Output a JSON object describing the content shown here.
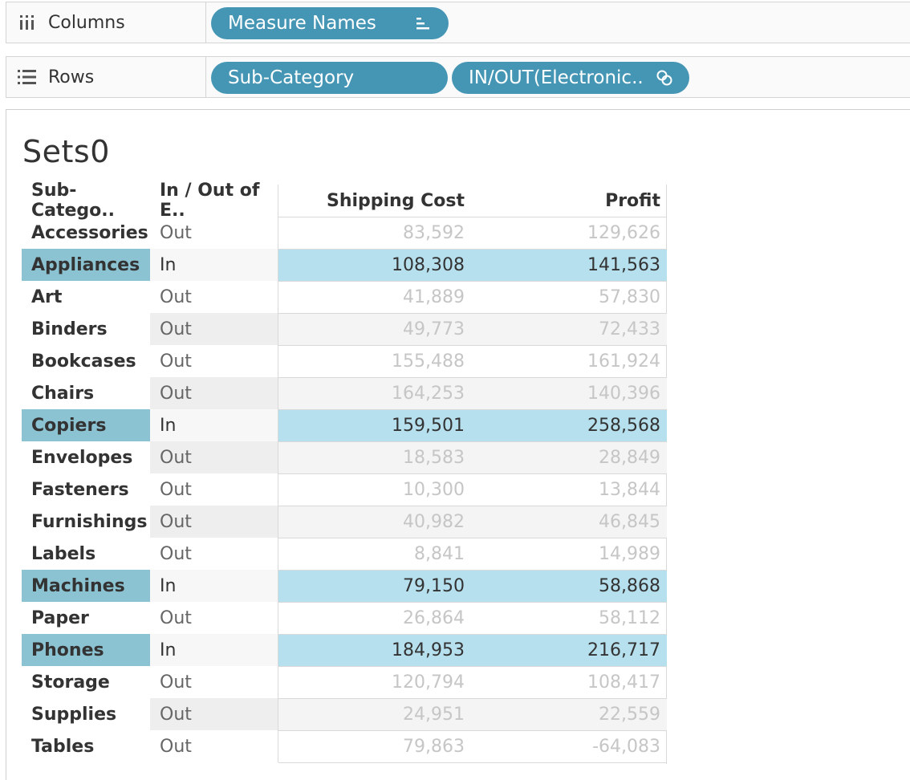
{
  "columns_shelf": {
    "label": "Columns",
    "icon": "columns-icon",
    "pills": [
      {
        "label": "Measure Names",
        "icon": "sort-icon"
      }
    ]
  },
  "rows_shelf": {
    "label": "Rows",
    "icon": "rows-icon",
    "pills": [
      {
        "label": "Sub-Category"
      },
      {
        "label": "IN/OUT(Electronic..",
        "icon": "set-icon"
      }
    ]
  },
  "sheet": {
    "title": "Sets0",
    "headers": {
      "sub_category": "Sub-Catego..",
      "in_out": "In / Out of E..",
      "shipping_cost": "Shipping Cost",
      "profit": "Profit"
    },
    "rows": [
      {
        "sub": "Accessories",
        "io": "Out",
        "ship": "83,592",
        "profit": "129,626"
      },
      {
        "sub": "Appliances",
        "io": "In",
        "ship": "108,308",
        "profit": "141,563"
      },
      {
        "sub": "Art",
        "io": "Out",
        "ship": "41,889",
        "profit": "57,830"
      },
      {
        "sub": "Binders",
        "io": "Out",
        "ship": "49,773",
        "profit": "72,433"
      },
      {
        "sub": "Bookcases",
        "io": "Out",
        "ship": "155,488",
        "profit": "161,924"
      },
      {
        "sub": "Chairs",
        "io": "Out",
        "ship": "164,253",
        "profit": "140,396"
      },
      {
        "sub": "Copiers",
        "io": "In",
        "ship": "159,501",
        "profit": "258,568"
      },
      {
        "sub": "Envelopes",
        "io": "Out",
        "ship": "18,583",
        "profit": "28,849"
      },
      {
        "sub": "Fasteners",
        "io": "Out",
        "ship": "10,300",
        "profit": "13,844"
      },
      {
        "sub": "Furnishings",
        "io": "Out",
        "ship": "40,982",
        "profit": "46,845"
      },
      {
        "sub": "Labels",
        "io": "Out",
        "ship": "8,841",
        "profit": "14,989"
      },
      {
        "sub": "Machines",
        "io": "In",
        "ship": "79,150",
        "profit": "58,868"
      },
      {
        "sub": "Paper",
        "io": "Out",
        "ship": "26,864",
        "profit": "58,112"
      },
      {
        "sub": "Phones",
        "io": "In",
        "ship": "184,953",
        "profit": "216,717"
      },
      {
        "sub": "Storage",
        "io": "Out",
        "ship": "120,794",
        "profit": "108,417"
      },
      {
        "sub": "Supplies",
        "io": "Out",
        "ship": "24,951",
        "profit": "22,559"
      },
      {
        "sub": "Tables",
        "io": "Out",
        "ship": "79,863",
        "profit": "-64,083"
      }
    ]
  },
  "colors": {
    "pill": "#4596b5",
    "highlight_label": "#8bc3d2",
    "highlight_cell": "#b7e0ee"
  }
}
